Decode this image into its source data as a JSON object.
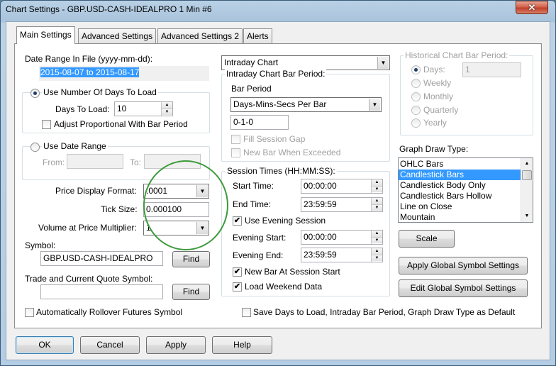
{
  "window": {
    "title": "Chart Settings - GBP.USD-CASH-IDEALPRO  1 Min   #6",
    "close_glyph": "✕"
  },
  "tabs": [
    {
      "label": "Main Settings",
      "active": true
    },
    {
      "label": "Advanced Settings",
      "active": false
    },
    {
      "label": "Advanced Settings 2",
      "active": false
    },
    {
      "label": "Alerts",
      "active": false
    }
  ],
  "date_range": {
    "label": "Date Range In File (yyyy-mm-dd):",
    "value": "2015-08-07 to 2015-08-17"
  },
  "days_to_load": {
    "radio_label": "Use Number Of Days To Load",
    "selected": true,
    "days_label": "Days To Load:",
    "days_value": "10",
    "adjust_label": "Adjust Proportional With Bar Period",
    "adjust_checked": false
  },
  "date_range_option": {
    "radio_label": "Use Date Range",
    "selected": false,
    "from_label": "From:",
    "to_label": "To:"
  },
  "price_display": {
    "label": "Price Display Format:",
    "value": ".0001"
  },
  "tick_size": {
    "label": "Tick Size:",
    "value": "0.000100"
  },
  "volume_multiplier": {
    "label": "Volume at Price Multiplier:",
    "value": "1"
  },
  "symbol": {
    "label": "Symbol:",
    "value": "GBP.USD-CASH-IDEALPRO",
    "find_label": "Find"
  },
  "trade_symbol": {
    "label": "Trade and Current Quote Symbol:",
    "value": "",
    "find_label": "Find"
  },
  "rollover": {
    "label": "Automatically Rollover Futures Symbol",
    "checked": false
  },
  "chart_type": {
    "value": "Intraday Chart"
  },
  "intraday_period": {
    "legend": "Intraday Chart Bar Period:",
    "bar_period_label": "Bar Period",
    "bar_period_value": "Days-Mins-Secs Per Bar",
    "period_value": "0-1-0",
    "fill_gap_label": "Fill Session Gap",
    "new_bar_label": "New Bar When Exceeded"
  },
  "session_times": {
    "legend": "Session Times (HH:MM:SS):",
    "start_label": "Start Time:",
    "start_value": "00:00:00",
    "end_label": "End Time:",
    "end_value": "23:59:59",
    "evening_label": "Use Evening Session",
    "evening_checked": true,
    "evening_start_label": "Evening Start:",
    "evening_start_value": "00:00:00",
    "evening_end_label": "Evening End:",
    "evening_end_value": "23:59:59",
    "new_bar_label": "New Bar At Session Start",
    "new_bar_checked": true,
    "weekend_label": "Load Weekend Data",
    "weekend_checked": true
  },
  "historical_period": {
    "legend": "Historical Chart Bar Period:",
    "options": [
      "Days:",
      "Weekly",
      "Monthly",
      "Quarterly",
      "Yearly"
    ],
    "days_value": "1"
  },
  "graph_draw": {
    "label": "Graph Draw Type:",
    "items": [
      "OHLC Bars",
      "Candlestick Bars",
      "Candlestick Body Only",
      "Candlestick Bars Hollow",
      "Line on Close",
      "Mountain"
    ],
    "selected": "Candlestick Bars"
  },
  "right_buttons": {
    "scale": "Scale",
    "apply_global": "Apply Global Symbol Settings",
    "edit_global": "Edit Global Symbol Settings"
  },
  "save_default": {
    "label": "Save Days to Load, Intraday Bar Period, Graph Draw Type as Default",
    "checked": false
  },
  "bottom_buttons": {
    "ok": "OK",
    "cancel": "Cancel",
    "apply": "Apply",
    "help": "Help"
  },
  "glyphs": {
    "check": "✔",
    "dropdown_arrow": "▼",
    "spin_up": "▲",
    "spin_down": "▼"
  },
  "colors": {
    "selection": "#3399ff",
    "annotation_circle": "#3c9a3c"
  }
}
